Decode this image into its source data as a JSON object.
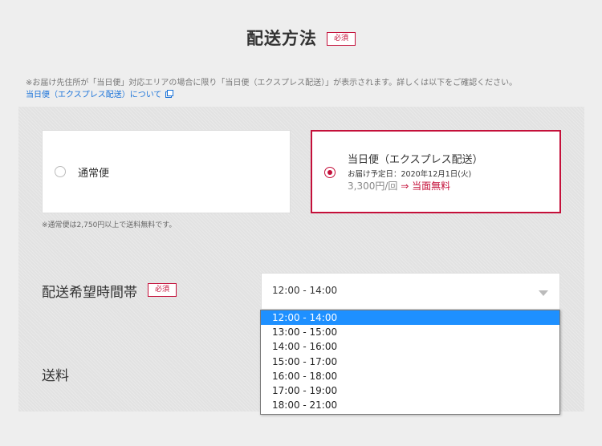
{
  "header": {
    "title": "配送方法",
    "required_badge": "必須"
  },
  "notice": "※お届け先住所が「当日便」対応エリアの場合に限り「当日便（エクスプレス配送）」が表示されます。詳しくは以下をご確認ください。",
  "about_link": "当日便（エクスプレス配送）について",
  "shipping_options": {
    "normal": {
      "label": "通常便",
      "selected": false,
      "note": "※通常便は2,750円以上で送料無料です。"
    },
    "express": {
      "title": "当日便（エクスプレス配送）",
      "date_line": "お届け予定日：2020年12月1日(火)",
      "price": "3,300円/回",
      "arrow": "⇒",
      "free_text": "当面無料",
      "selected": true
    }
  },
  "time_slot": {
    "label": "配送希望時間帯",
    "required_badge": "必須",
    "selected_value": "12:00 - 14:00",
    "options": [
      "12:00 - 14:00",
      "13:00 - 15:00",
      "14:00 - 16:00",
      "15:00 - 17:00",
      "16:00 - 18:00",
      "17:00 - 19:00",
      "18:00 - 21:00"
    ],
    "highlighted_index": 0
  },
  "shipping_fee": {
    "label": "送料"
  },
  "colors": {
    "accent": "#c4103a",
    "link": "#1a73d9",
    "highlight": "#1e90ff"
  },
  "icons": {
    "external_link": "external-link-icon",
    "dropdown_arrow": "triangle-down-icon"
  }
}
